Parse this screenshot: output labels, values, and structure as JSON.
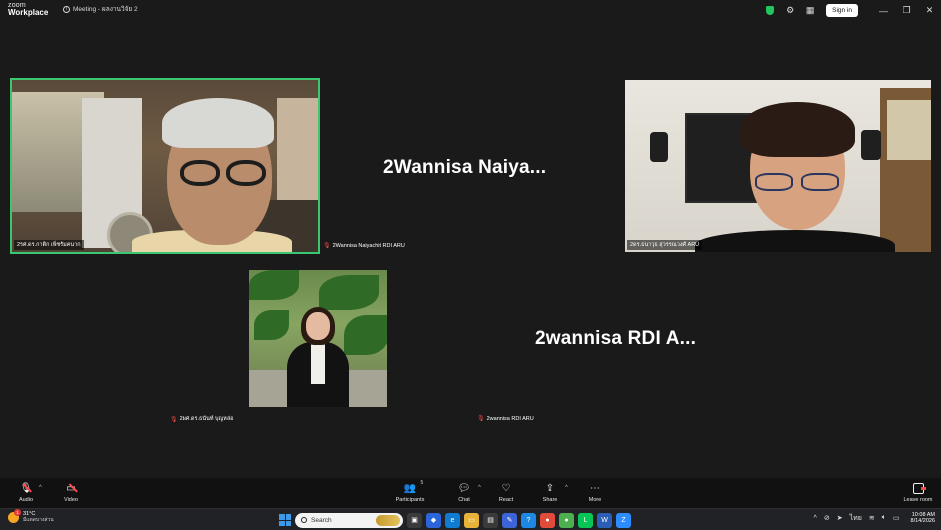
{
  "titlebar": {
    "logo_line1": "zoom",
    "logo_line2": "Workplace",
    "meeting_title": "Meeting - ผลงานวิจัย 2",
    "sign_in": "Sign in"
  },
  "stage": {
    "participants": [
      {
        "name": "2รศ.ดร.กาติก เพ็ชรัมคนาก",
        "type": "video",
        "active_speaker": true,
        "muted": false
      },
      {
        "name": "2Wannisa Naiyachit RDI ARU",
        "type": "name-only",
        "display_name": "2Wannisa  Naiya...",
        "muted": true
      },
      {
        "name": "2ดร.ธนาวุธ สุวรรณวงศ์ ARU",
        "type": "video",
        "muted": false
      },
      {
        "name": "2ผศ.ดร.ธนันท์ บุญหล่อ",
        "type": "picture",
        "muted": true
      },
      {
        "name": "2wannisa  RDI ARU",
        "type": "name-only",
        "display_name": "2wannisa  RDI  A...",
        "muted": true
      }
    ]
  },
  "controls": {
    "audio": "Audio",
    "video": "Video",
    "participants": "Participants",
    "participants_count": "5",
    "chat": "Chat",
    "react": "React",
    "share": "Share",
    "more": "More",
    "leave": "Leave room"
  },
  "taskbar": {
    "weather_temp": "31°C",
    "weather_desc": "มีแดดบางส่วน",
    "weather_badge": "1",
    "search_placeholder": "Search",
    "time": "10:08 AM",
    "date": "8/14/2026"
  },
  "colors": {
    "active_speaker_border": "#3ac770",
    "muted_icon": "#ff4a4a",
    "shield": "#22c55e"
  }
}
